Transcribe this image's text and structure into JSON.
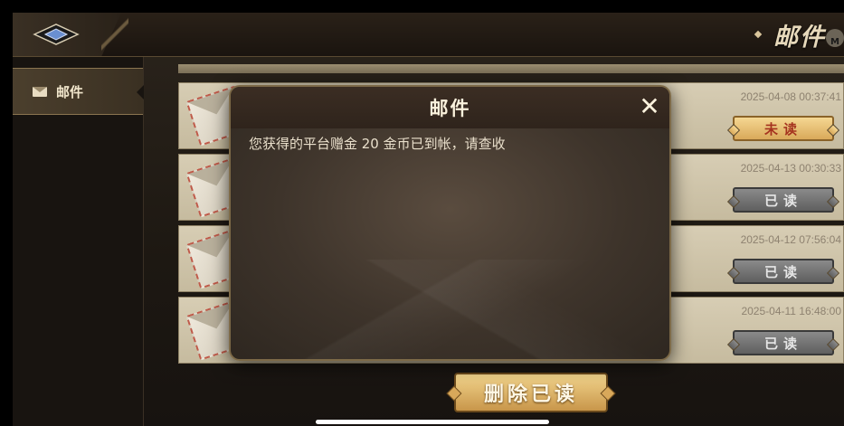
{
  "header": {
    "title": "邮件",
    "corner_badge": "M"
  },
  "sidebar": {
    "items": [
      {
        "label": "邮件",
        "icon": "envelope-icon"
      }
    ]
  },
  "mails": [
    {
      "date": "2025-04-08 00:37:41",
      "status": "未读",
      "read": false
    },
    {
      "date": "2025-04-13 00:30:33",
      "status": "已读",
      "read": true
    },
    {
      "date": "2025-04-12 07:56:04",
      "status": "已读",
      "read": true
    },
    {
      "date": "2025-04-11 16:48:00",
      "status": "已读",
      "read": true
    }
  ],
  "delete_button": {
    "label": "删除已读"
  },
  "modal": {
    "title": "邮件",
    "close": "✕",
    "message": "您获得的平台赠金 20 金币已到帐，请查收"
  },
  "colors": {
    "accent_gold": "#d9a95a",
    "unread_text": "#a5331f",
    "read_gray": "#6f6f6f"
  }
}
